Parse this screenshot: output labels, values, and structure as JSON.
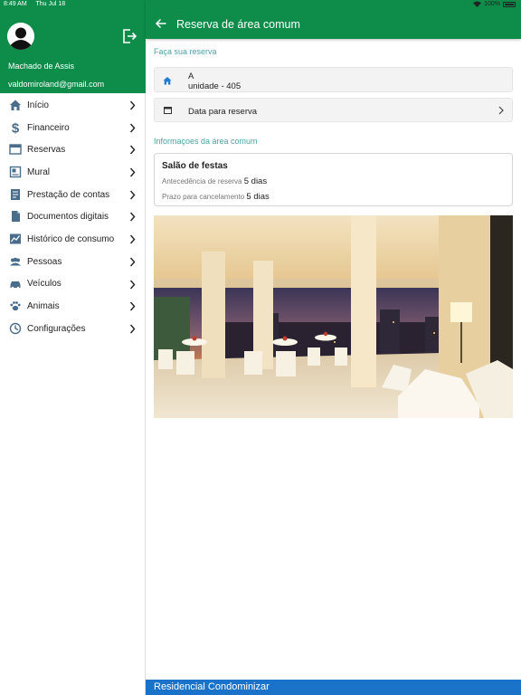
{
  "status_bar": {
    "time": "8:49 AM",
    "date": "Thu Jul 18",
    "battery": "100%"
  },
  "colors": {
    "primary": "#0d8c4a",
    "footer": "#1a73c8",
    "section_label": "#4aa3a8",
    "menu_icon": "#4a6d8c"
  },
  "sidebar": {
    "user_name": "Machado de Assis",
    "user_email": "valdomiroland@gmail.com",
    "items": [
      {
        "label": "Início",
        "icon": "home-icon"
      },
      {
        "label": "Financeiro",
        "icon": "dollar-icon"
      },
      {
        "label": "Reservas",
        "icon": "calendar-icon"
      },
      {
        "label": "Mural",
        "icon": "board-icon"
      },
      {
        "label": "Prestação de contas",
        "icon": "report-icon"
      },
      {
        "label": "Documentos digitais",
        "icon": "document-icon"
      },
      {
        "label": "Histórico de consumo",
        "icon": "chart-icon"
      },
      {
        "label": "Pessoas",
        "icon": "people-icon"
      },
      {
        "label": "Veículos",
        "icon": "car-icon"
      },
      {
        "label": "Animais",
        "icon": "paw-icon"
      },
      {
        "label": "Configurações",
        "icon": "settings-icon"
      }
    ]
  },
  "header": {
    "title": "Reserva de área comum"
  },
  "reservation": {
    "section_title": "Faça sua reserva",
    "unit_block": "A",
    "unit_name": "unidade - 405",
    "date_label": "Data para reserva"
  },
  "info": {
    "section_title": "Informaçoes da área comum",
    "area_name": "Salão de festas",
    "antecedencia_label": "Antecedência de reserva",
    "antecedencia_value": "5 dias",
    "prazo_label": "Prazo para cancelamento",
    "prazo_value": "5 dias"
  },
  "footer": {
    "text": "Residencial Condominizar"
  }
}
